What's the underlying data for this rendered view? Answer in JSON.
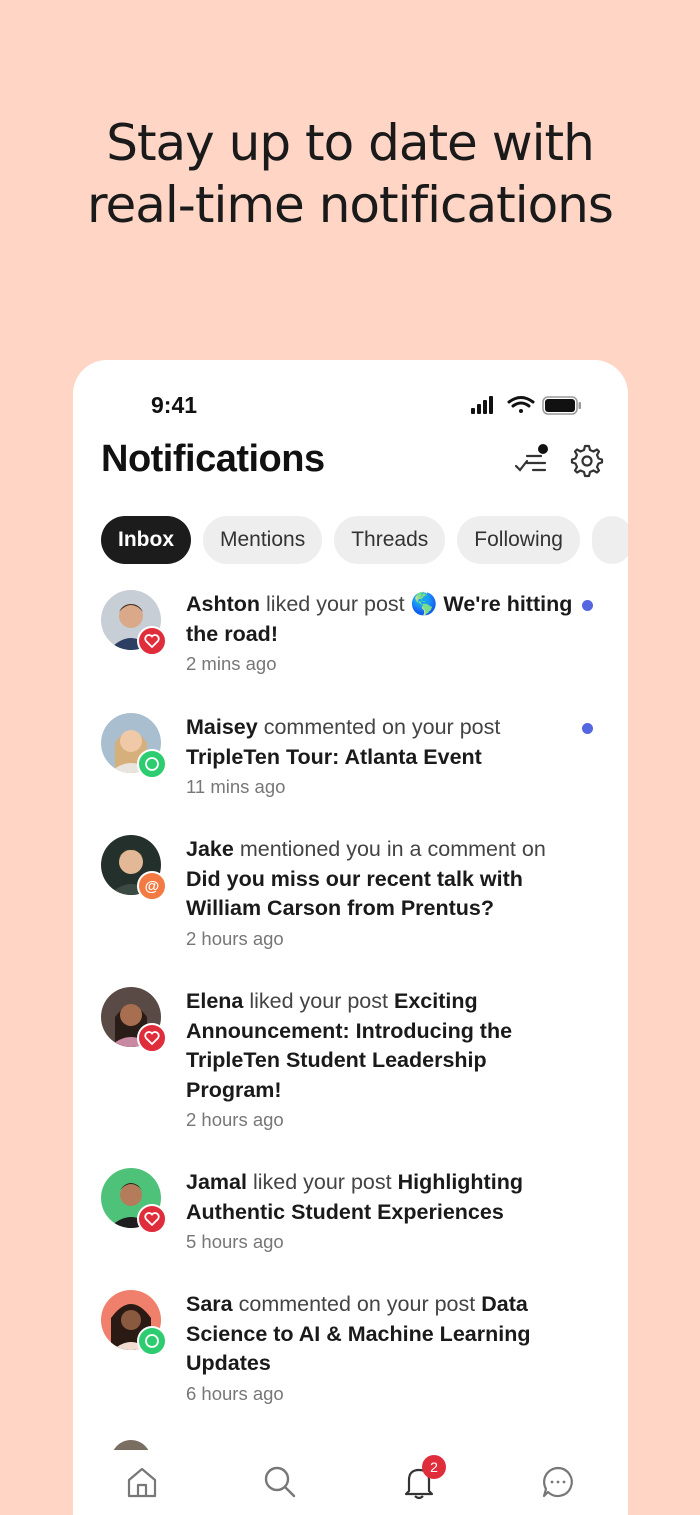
{
  "headline": {
    "line1": "Stay up to date with",
    "line2": "real-time notifications"
  },
  "status_bar": {
    "time": "9:41"
  },
  "header": {
    "title": "Notifications"
  },
  "tabs": [
    {
      "label": "Inbox",
      "active": true
    },
    {
      "label": "Mentions",
      "active": false
    },
    {
      "label": "Threads",
      "active": false
    },
    {
      "label": "Following",
      "active": false
    }
  ],
  "notifications": [
    {
      "name": "Ashton",
      "action": "liked your post",
      "emoji": "🌎",
      "post": "We're hitting the road!",
      "time": "2 mins ago",
      "badge": "heart-icon",
      "unread": true
    },
    {
      "name": "Maisey",
      "action": "commented on your post",
      "post": "TripleTen Tour: Atlanta Event",
      "time": "11 mins ago",
      "badge": "comment-icon",
      "unread": true
    },
    {
      "name": "Jake",
      "action": "mentioned you in a comment on",
      "post": "Did you miss our recent talk with William Carson from Prentus?",
      "time": "2 hours ago",
      "badge": "at-sign-icon",
      "unread": false
    },
    {
      "name": "Elena",
      "action": "liked your post",
      "post": "Exciting Announcement: Introducing the TripleTen Student Leadership Program!",
      "time": "2 hours ago",
      "badge": "heart-icon",
      "unread": false
    },
    {
      "name": "Jamal",
      "action": "liked your post",
      "post": "Highlighting Authentic Student Experiences",
      "time": "5 hours ago",
      "badge": "heart-icon",
      "unread": false
    },
    {
      "name": "Sara",
      "action": "commented on your post",
      "post": "Data Science to AI & Machine Learning Updates",
      "time": "6 hours ago",
      "badge": "comment-icon",
      "unread": false
    }
  ],
  "bottom_nav": {
    "items": [
      "home-icon",
      "search-icon",
      "bell-icon",
      "chat-icon"
    ],
    "notification_count": "2"
  },
  "colors": {
    "background": "#ffd5c6",
    "accent_unread": "#5567e0",
    "like": "#e02d3c",
    "comment": "#2ecc71",
    "mention": "#f47a44"
  }
}
